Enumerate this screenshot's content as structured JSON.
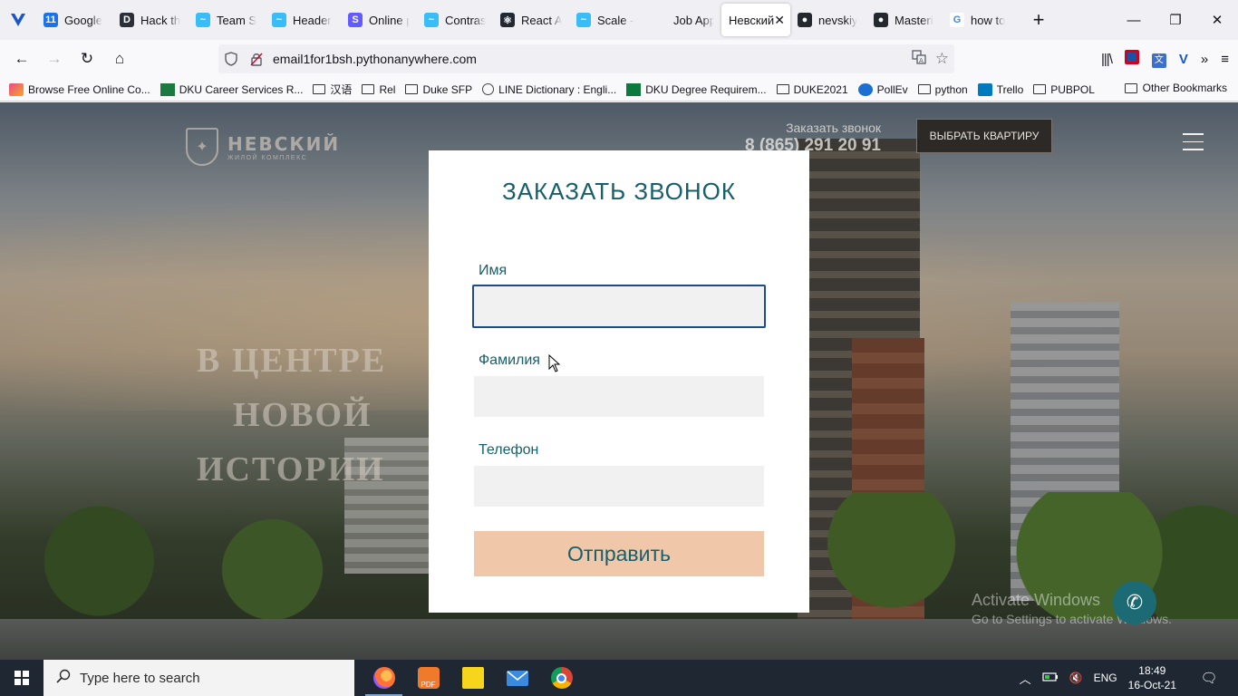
{
  "browser": {
    "tabs": [
      {
        "title": "Google",
        "icon": "calendar-icon",
        "color": "#1a73e8",
        "glyph": "11"
      },
      {
        "title": "Hack th",
        "icon": "hack-icon",
        "color": "#2b2f3a",
        "glyph": "D"
      },
      {
        "title": "Team S",
        "icon": "tailwind-icon",
        "color": "#38bdf8",
        "glyph": "~"
      },
      {
        "title": "Header",
        "icon": "tailwind-icon",
        "color": "#38bdf8",
        "glyph": "~"
      },
      {
        "title": "Online p",
        "icon": "stripe-icon",
        "color": "#635bff",
        "glyph": "S"
      },
      {
        "title": "Contras",
        "icon": "tailwind-icon",
        "color": "#38bdf8",
        "glyph": "~"
      },
      {
        "title": "React A",
        "icon": "react-icon",
        "color": "#222831",
        "glyph": "⚛"
      },
      {
        "title": "Scale -",
        "icon": "tailwind-icon",
        "color": "#38bdf8",
        "glyph": "~"
      },
      {
        "title": "Job App",
        "icon": "blank-icon",
        "color": "#f0f0f4",
        "glyph": ""
      },
      {
        "title": "Невский",
        "icon": "blank-icon",
        "color": "#ffffff",
        "glyph": "",
        "active": true
      },
      {
        "title": "nevskiy",
        "icon": "github-icon",
        "color": "#24292f",
        "glyph": "●"
      },
      {
        "title": "Masteri",
        "icon": "github-icon",
        "color": "#24292f",
        "glyph": "●"
      },
      {
        "title": "how to",
        "icon": "google-icon",
        "color": "#ffffff",
        "glyph": "G"
      }
    ],
    "close_glyph": "✕",
    "new_tab_glyph": "+",
    "window_controls": {
      "minimize": "—",
      "restore": "❐",
      "close": "✕"
    },
    "url": "email1for1bsh.pythonanywhere.com",
    "nav": {
      "back": "←",
      "forward": "→",
      "reload": "↻",
      "home": "⌂"
    }
  },
  "bookmarks": [
    {
      "label": "Browse Free Online Co...",
      "icon": "bookmark-site-icon"
    },
    {
      "label": "DKU Career Services R...",
      "icon": "excel-icon"
    },
    {
      "label": "汉语",
      "icon": "folder-icon"
    },
    {
      "label": "Rel",
      "icon": "folder-icon"
    },
    {
      "label": "Duke SFP",
      "icon": "folder-icon"
    },
    {
      "label": "LINE Dictionary : Engli...",
      "icon": "globe-icon"
    },
    {
      "label": "DKU Degree Requirem...",
      "icon": "plus-doc-icon"
    },
    {
      "label": "DUKE2021",
      "icon": "folder-icon"
    },
    {
      "label": "PollEv",
      "icon": "pollev-icon"
    },
    {
      "label": "python",
      "icon": "folder-icon"
    },
    {
      "label": "Trello",
      "icon": "trello-icon"
    },
    {
      "label": "PUBPOL",
      "icon": "folder-icon"
    }
  ],
  "bookmarks_other": "Other Bookmarks",
  "site": {
    "logo_name": "НЕВСКИЙ",
    "logo_sub": "ЖИЛОЙ КОМПЛЕКС",
    "call_label": "Заказать звонок",
    "phone": "8 (865) 291 20 91",
    "choose_button": "ВЫБРАТЬ КВАРТИРУ",
    "hero_lines": [
      "В ЦЕНТРЕ",
      "НОВОЙ",
      "ИСТОРИИ"
    ]
  },
  "modal": {
    "title": "ЗАКАЗАТЬ ЗВОНОК",
    "fields": [
      {
        "label": "Имя",
        "value": ""
      },
      {
        "label": "Фамилия",
        "value": ""
      },
      {
        "label": "Телефон",
        "value": ""
      }
    ],
    "submit": "Отправить"
  },
  "watermark": {
    "line1": "Activate Windows",
    "line2": "Go to Settings to activate Windows."
  },
  "taskbar": {
    "search_placeholder": "Type here to search",
    "language": "ENG",
    "time": "18:49",
    "date": "16-Oct-21"
  }
}
